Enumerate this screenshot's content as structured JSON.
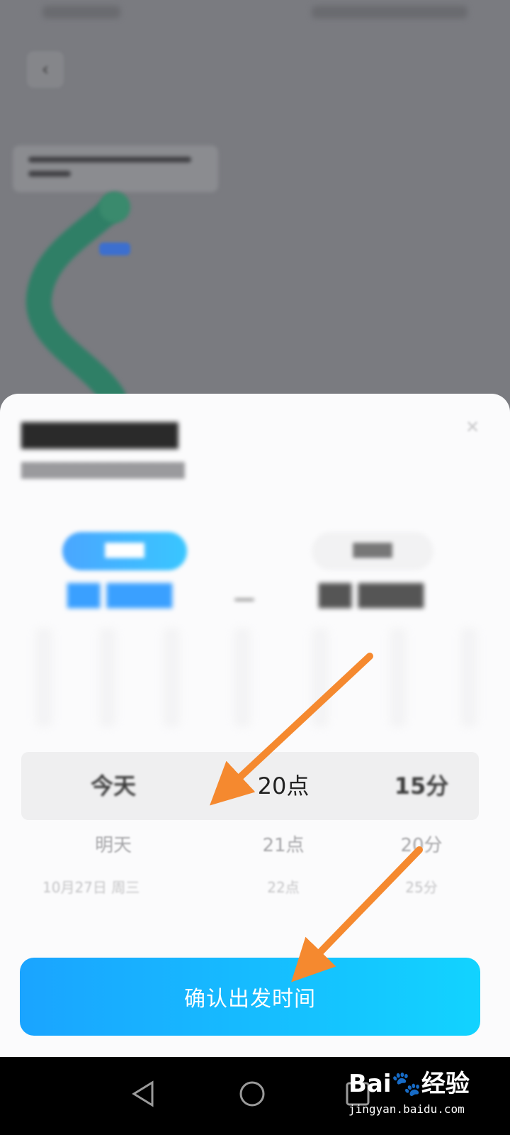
{
  "sheet": {
    "close_icon": "close-icon"
  },
  "picker": {
    "columns": [
      {
        "selected": "今天",
        "next": "明天",
        "next2": "10月27日 周三"
      },
      {
        "selected": "20点",
        "next": "21点",
        "next2": "22点"
      },
      {
        "selected": "15分",
        "next": "20分",
        "next2": "25分"
      }
    ]
  },
  "confirm_button": {
    "label": "确认出发时间"
  },
  "navbar": {
    "back_icon": "triangle-back-icon",
    "home_icon": "circle-home-icon",
    "recents_icon": "square-recents-icon"
  },
  "watermark": {
    "logo_text": "Bai🐾经验",
    "url": "jingyan.baidu.com"
  },
  "colors": {
    "accent": "#1aa4ff",
    "accent_end": "#12d3ff",
    "annotation_arrow": "#f5892f",
    "map_background": "#7a7b80"
  }
}
